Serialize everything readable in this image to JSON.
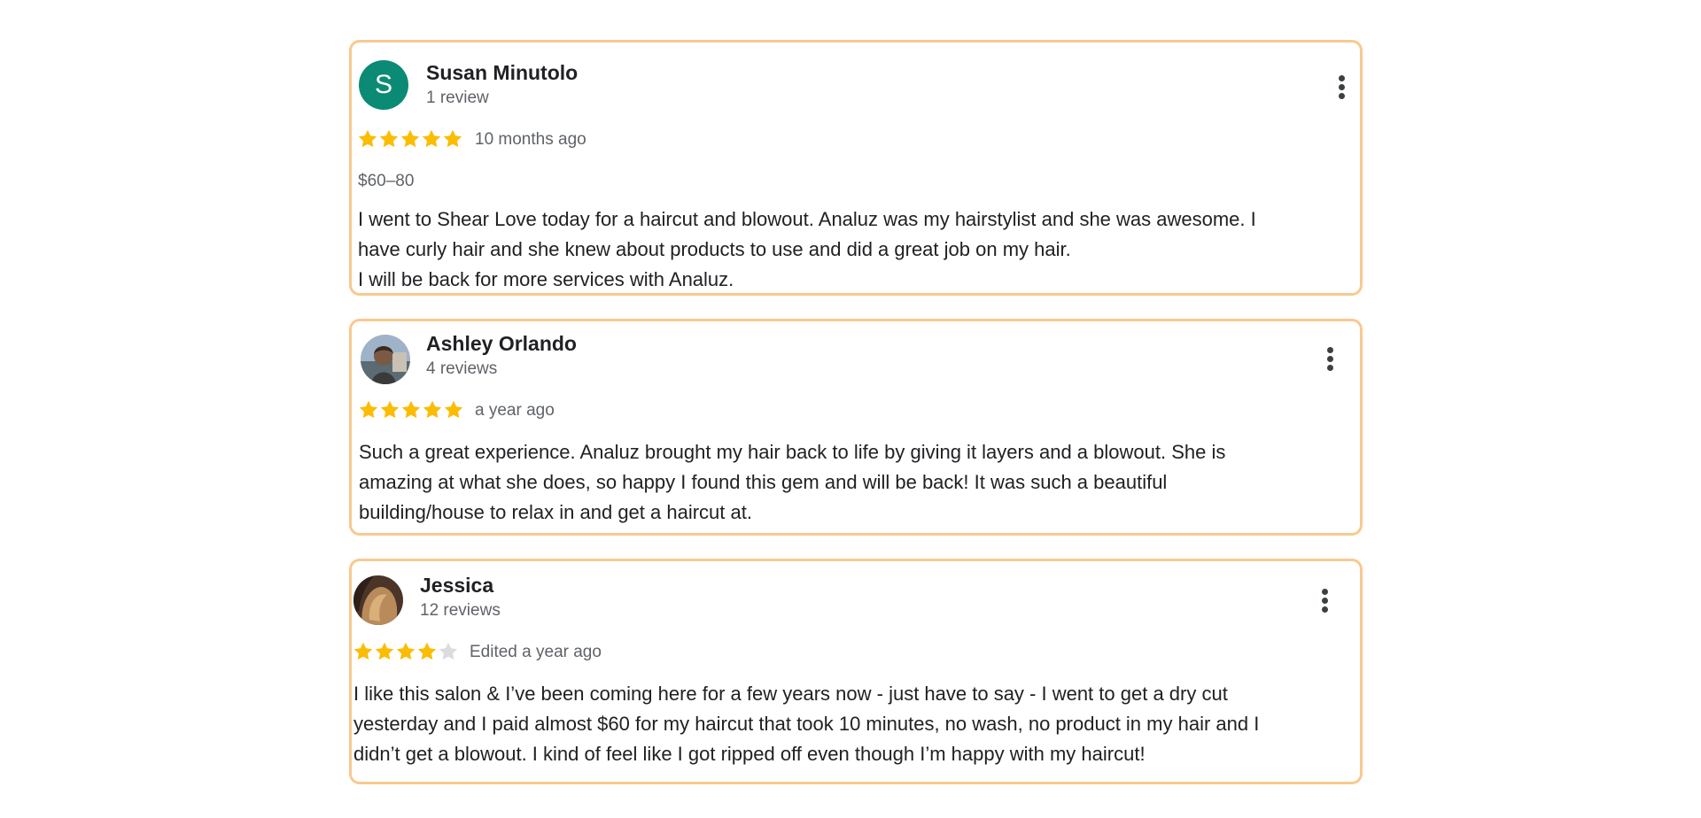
{
  "colors": {
    "card_border": "#f8c98e",
    "star_filled": "#fbbc04",
    "star_empty": "#dadce0",
    "avatar_bg": "#0b8a75"
  },
  "reviews": [
    {
      "author": "Susan Minutolo",
      "avatar_letter": "S",
      "review_count": "1 review",
      "rating": 5,
      "date": "10 months ago",
      "price": "$60–80",
      "text_lines": [
        "I went to Shear Love today for a haircut and blowout. Analuz was my hairstylist and she was awesome. I",
        "have curly hair and she knew about products to use and did a great job on my hair.",
        "I will be back for more services with Analuz."
      ],
      "menu_icon": "more-vert-icon"
    },
    {
      "author": "Ashley Orlando",
      "review_count": "4 reviews",
      "rating": 5,
      "date": "a year ago",
      "text_lines": [
        "Such a great experience. Analuz brought my hair back to life by giving it layers and a blowout. She is",
        "amazing at what she does, so happy I found this gem and will be back! It was such a beautiful",
        "building/house to relax in and get a haircut at."
      ],
      "menu_icon": "more-vert-icon"
    },
    {
      "author": "Jessica",
      "review_count": "12 reviews",
      "rating": 4,
      "date": "Edited a year ago",
      "text_lines": [
        "I like this salon & I’ve been coming here for a few years now - just have to say - I went to get a dry cut",
        "yesterday and I paid almost $60 for my haircut that took 10 minutes, no wash, no product in my hair and I",
        "didn’t get a blowout. I kind of feel like I got ripped off even though I’m happy with my haircut!"
      ],
      "menu_icon": "more-vert-icon"
    }
  ]
}
